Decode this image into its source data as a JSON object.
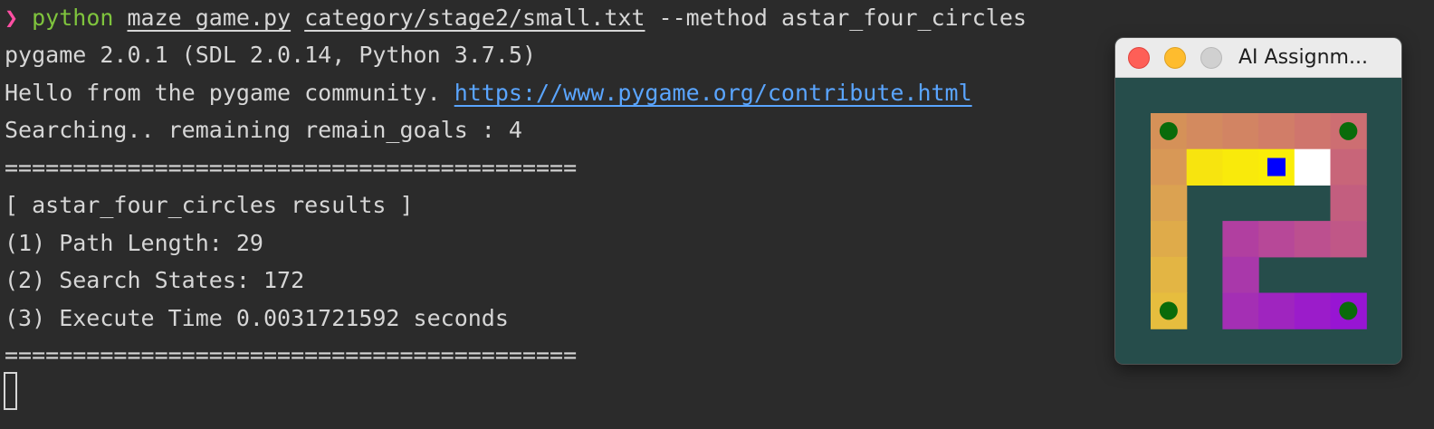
{
  "terminal": {
    "prompt_symbol": "❯",
    "command": {
      "program": "python",
      "script": "maze_game.py",
      "maze_file": "category/stage2/small.txt",
      "args": "--method astar_four_circles"
    },
    "lines": [
      "pygame 2.0.1 (SDL 2.0.14, Python 3.7.5)",
      "Searching.. remaining remain_goals : 4",
      "==========================================",
      "[ astar_four_circles results ]",
      "(1) Path Length: 29",
      "(2) Search States: 172",
      "(3) Execute Time 0.0031721592 seconds",
      "=========================================="
    ],
    "hello_prefix": "Hello from the pygame community. ",
    "hello_link": "https://www.pygame.org/contribute.html"
  },
  "window": {
    "title": "AI Assignm...",
    "buttons": [
      "close",
      "minimize",
      "zoom"
    ]
  },
  "maze": {
    "background_color": "#264d4b",
    "goal_color": "#0a6b0a",
    "agent_color": "#0000ff",
    "goals": [
      [
        0,
        0
      ],
      [
        5,
        0
      ],
      [
        0,
        5
      ],
      [
        5,
        5
      ]
    ],
    "agent": [
      3,
      1
    ],
    "path_cells": [
      {
        "c": 0,
        "r": 0,
        "color": "#d59158"
      },
      {
        "c": 1,
        "r": 0,
        "color": "#d38a5f"
      },
      {
        "c": 2,
        "r": 0,
        "color": "#d28463"
      },
      {
        "c": 3,
        "r": 0,
        "color": "#d17d68"
      },
      {
        "c": 4,
        "r": 0,
        "color": "#cf756d"
      },
      {
        "c": 5,
        "r": 0,
        "color": "#cd6e72"
      },
      {
        "c": 0,
        "r": 1,
        "color": "#d89856"
      },
      {
        "c": 1,
        "r": 1,
        "color": "#f7e40f"
      },
      {
        "c": 2,
        "r": 1,
        "color": "#f9ea0b"
      },
      {
        "c": 3,
        "r": 1,
        "color": "#faed08"
      },
      {
        "c": 4,
        "r": 1,
        "color": "#ffffff"
      },
      {
        "c": 5,
        "r": 1,
        "color": "#c86579"
      },
      {
        "c": 0,
        "r": 2,
        "color": "#dba251"
      },
      {
        "c": 5,
        "r": 2,
        "color": "#c35e7f"
      },
      {
        "c": 0,
        "r": 3,
        "color": "#dfab4a"
      },
      {
        "c": 2,
        "r": 3,
        "color": "#b13fa0"
      },
      {
        "c": 3,
        "r": 3,
        "color": "#b74898"
      },
      {
        "c": 4,
        "r": 3,
        "color": "#bc508f"
      },
      {
        "c": 5,
        "r": 3,
        "color": "#c05787"
      },
      {
        "c": 0,
        "r": 4,
        "color": "#e3b544"
      },
      {
        "c": 2,
        "r": 4,
        "color": "#a938aa"
      },
      {
        "c": 0,
        "r": 5,
        "color": "#e6bd3e"
      },
      {
        "c": 2,
        "r": 5,
        "color": "#a42fb4"
      },
      {
        "c": 3,
        "r": 5,
        "color": "#9f25bf"
      },
      {
        "c": 4,
        "r": 5,
        "color": "#9b1cca"
      },
      {
        "c": 5,
        "r": 5,
        "color": "#9815d3"
      }
    ]
  }
}
